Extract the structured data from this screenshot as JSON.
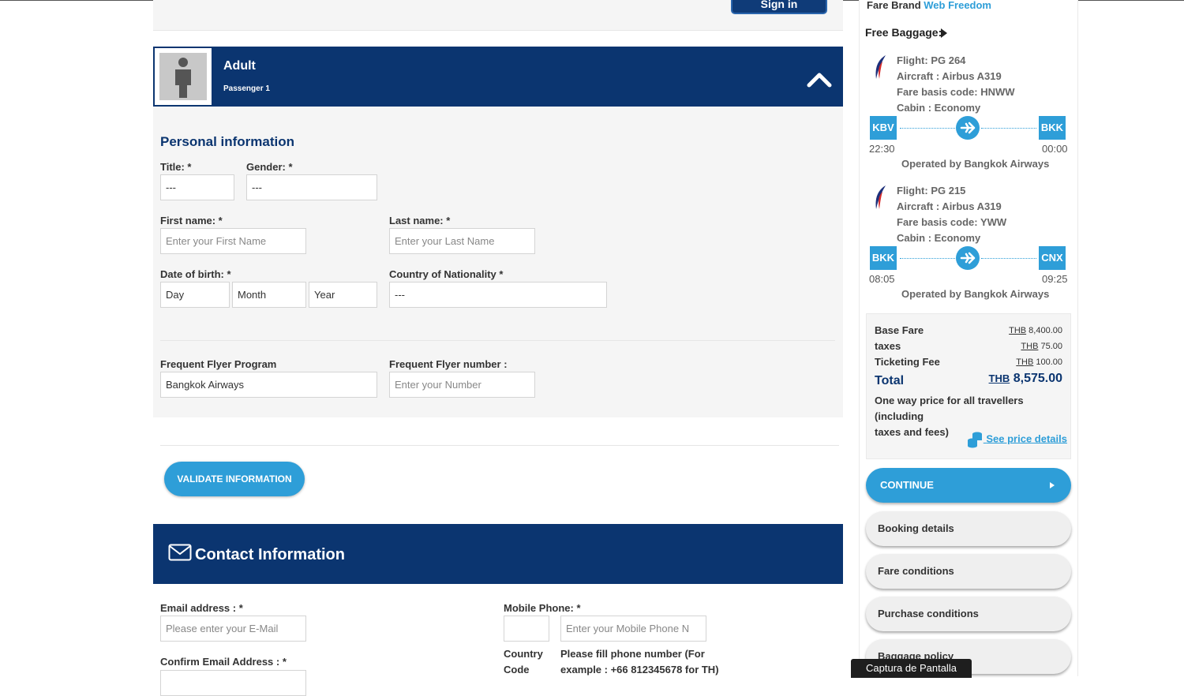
{
  "header": {
    "sign_in_label": "Sign in"
  },
  "passenger": {
    "type": "Adult",
    "index_label": "Passenger 1"
  },
  "personal": {
    "section_title": "Personal information",
    "title_label": "Title: *",
    "title_value": "---",
    "gender_label": "Gender: *",
    "gender_value": "---",
    "first_name_label": "First name: *",
    "first_name_placeholder": "Enter your First Name",
    "last_name_label": "Last name: *",
    "last_name_placeholder": "Enter your Last Name",
    "dob_label": "Date of birth: *",
    "dob_day": "Day",
    "dob_month": "Month",
    "dob_year": "Year",
    "nationality_label": "Country of Nationality *",
    "nationality_value": "---",
    "ffp_label": "Frequent Flyer Program",
    "ffp_value": "Bangkok Airways",
    "ffn_label": "Frequent Flyer number :",
    "ffn_placeholder": "Enter your Number"
  },
  "validate_label": "VALIDATE INFORMATION",
  "contact": {
    "title": "Contact Information",
    "email_label": "Email address : *",
    "email_placeholder": "Please enter your E-Mail",
    "confirm_email_label": "Confirm Email Address : *",
    "mobile_label": "Mobile Phone: *",
    "mobile_placeholder": "Enter your Mobile Phone N",
    "country_code_line1": "Country",
    "country_code_line2": "Code",
    "phone_note_line1": "Please fill phone number (For",
    "phone_note_line2": "example : +66 812345678 for TH)"
  },
  "summary": {
    "fare_brand_label": "Fare Brand",
    "fare_brand_value": "Web Freedom",
    "free_baggage_label": "Free Baggage:",
    "flights": [
      {
        "flight": "Flight: PG 264",
        "aircraft": "Aircraft : Airbus A319",
        "fare_basis": "Fare basis code: HNWW",
        "cabin": "Cabin : Economy",
        "from": "KBV",
        "to": "BKK",
        "dep": "22:30",
        "arr": "00:00",
        "operator": "Operated by Bangkok Airways"
      },
      {
        "flight": "Flight: PG 215",
        "aircraft": "Aircraft : Airbus A319",
        "fare_basis": "Fare basis code: YWW",
        "cabin": "Cabin : Economy",
        "from": "BKK",
        "to": "CNX",
        "dep": "08:05",
        "arr": "09:25",
        "operator": "Operated by Bangkok Airways"
      }
    ],
    "price": {
      "currency": "THB",
      "base_fare_label": "Base Fare",
      "base_fare_value": "8,400.00",
      "taxes_label": "taxes",
      "taxes_value": "75.00",
      "ticketing_label": "Ticketing Fee",
      "ticketing_value": "100.00",
      "total_label": "Total",
      "total_value": "8,575.00",
      "note_line1": "One way price for all travellers (including",
      "note_line2": "taxes and fees)",
      "details_link": "See price details"
    },
    "continue_label": "CONTINUE",
    "booking_details": "Booking details",
    "fare_conditions": "Fare conditions",
    "purchase_conditions": "Purchase conditions",
    "baggage_policy": "Baggage policy"
  },
  "tooltip": "Captura de Pantalla",
  "colors": {
    "navy": "#0b3570",
    "accent": "#2e9ed8",
    "panel": "#f5f5f5"
  }
}
